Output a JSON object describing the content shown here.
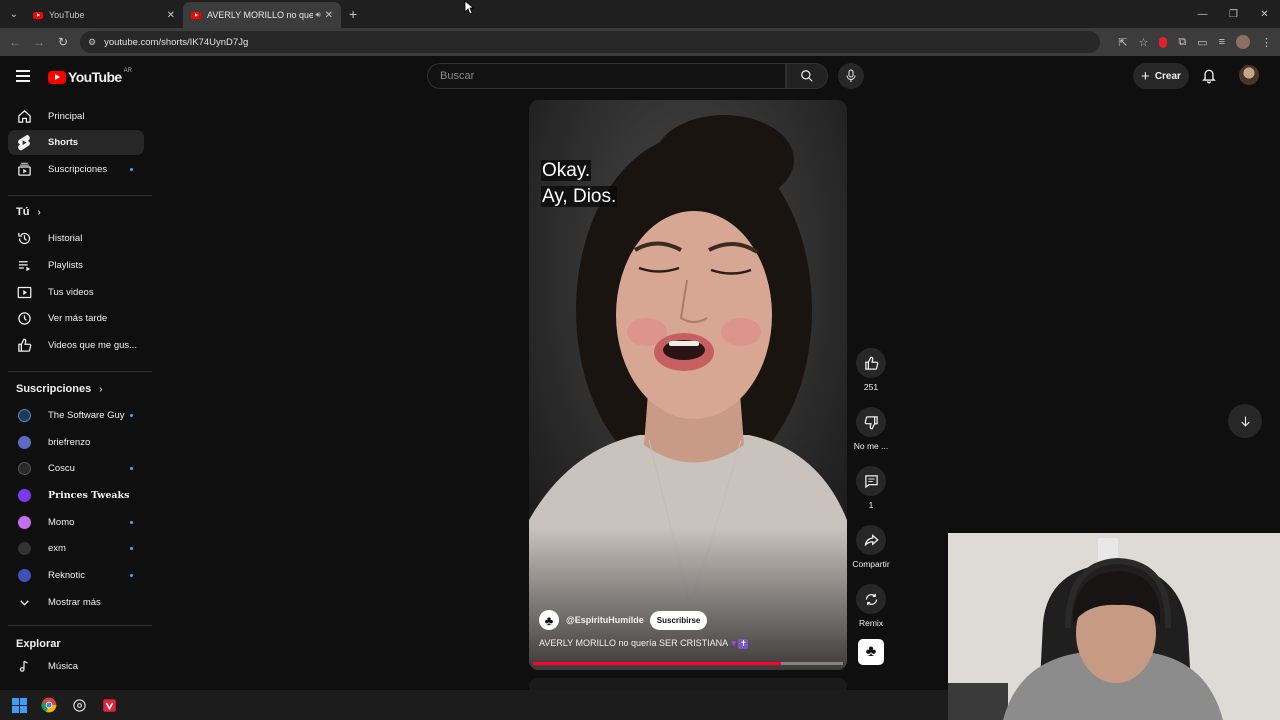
{
  "browser": {
    "tabs": [
      {
        "title": "YouTube",
        "active": false
      },
      {
        "title": "AVERLY MORILLO no quería",
        "active": true,
        "audio": true
      }
    ],
    "url": "youtube.com/shorts/IK74UynD7Jg"
  },
  "header": {
    "logo_text": "YouTube",
    "country_code": "AR",
    "search_placeholder": "Buscar",
    "create_label": "Crear"
  },
  "sidebar": {
    "main": [
      {
        "label": "Principal",
        "icon": "home-icon"
      },
      {
        "label": "Shorts",
        "icon": "shorts-icon",
        "active": true
      },
      {
        "label": "Suscripciones",
        "icon": "subscriptions-icon",
        "new": true
      }
    ],
    "you_heading": "Tú",
    "you": [
      {
        "label": "Historial",
        "icon": "history-icon"
      },
      {
        "label": "Playlists",
        "icon": "playlists-icon"
      },
      {
        "label": "Tus videos",
        "icon": "your-videos-icon"
      },
      {
        "label": "Ver más tarde",
        "icon": "watch-later-icon"
      },
      {
        "label": "Videos que me gus...",
        "icon": "liked-icon"
      }
    ],
    "subs_heading": "Suscripciones",
    "subscriptions": [
      {
        "label": "The Software Guy",
        "color": "#1b3a5c",
        "new": true
      },
      {
        "label": "briefrenzo",
        "color": "#5c6bc0",
        "new": false
      },
      {
        "label": "Coscu",
        "color": "#2a2a2a",
        "new": true
      },
      {
        "label": "Princes Tweaks",
        "color": "#7c3aed",
        "new": false
      },
      {
        "label": "Momo",
        "color": "#c56cf0",
        "new": true
      },
      {
        "label": "exm",
        "color": "#333333",
        "new": true
      },
      {
        "label": "Reknotic",
        "color": "#3f51b5",
        "new": true
      }
    ],
    "show_more": "Mostrar más",
    "explore_heading": "Explorar",
    "explore": [
      {
        "label": "Música",
        "icon": "music-icon"
      }
    ]
  },
  "short": {
    "caption_lines": [
      "Okay.",
      "Ay, Dios."
    ],
    "channel": "@EspirituHumilde",
    "subscribe_label": "Suscribirse",
    "title": "AVERLY MORILLO no quería SER CRISTIANA",
    "progress_fraction": 0.8,
    "actions": {
      "likes": "251",
      "dislike_label": "No me ...",
      "comments": "1",
      "share_label": "Compartir",
      "remix_label": "Remix"
    }
  }
}
